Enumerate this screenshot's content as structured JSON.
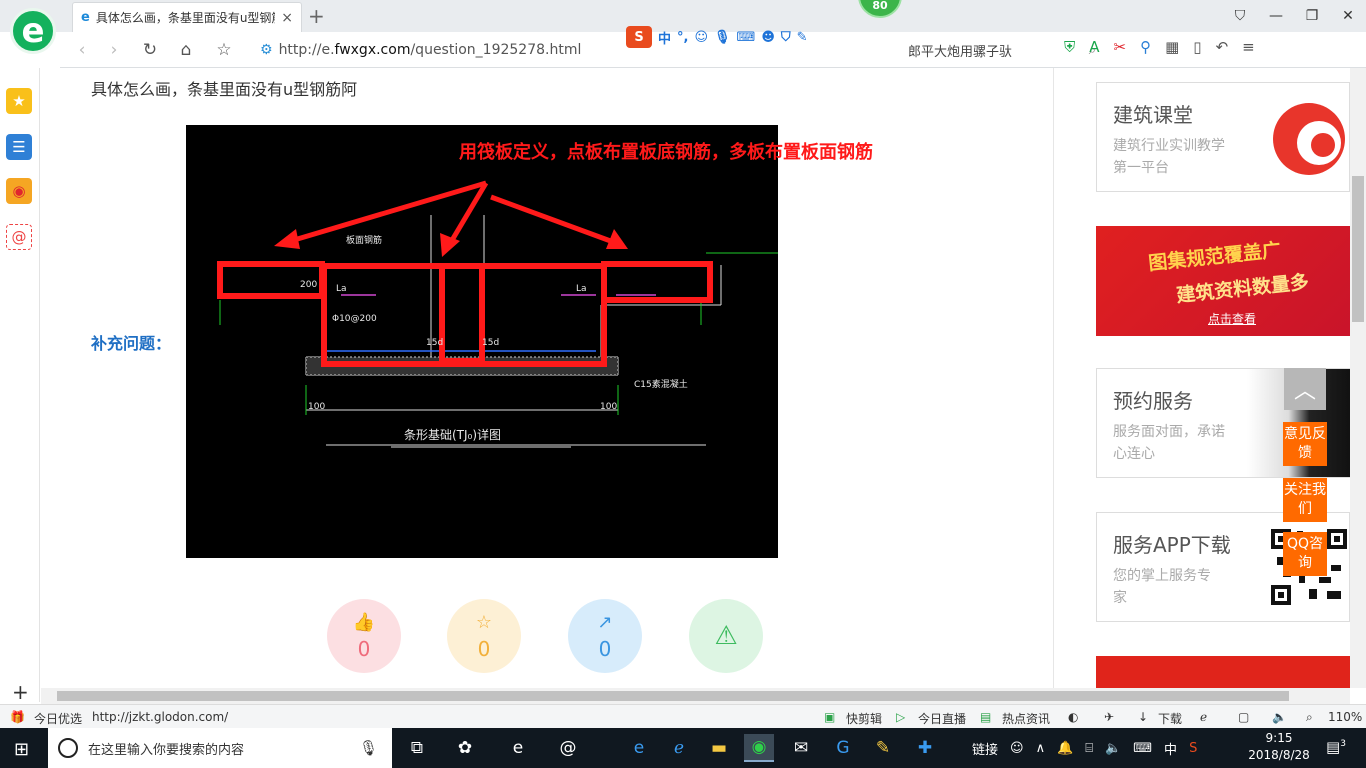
{
  "browser": {
    "tab_title": "具体怎么画，条基里面没有u型钢筋",
    "tab_close": "×",
    "new_tab": "+",
    "address_prefix": "http://e.",
    "address_domain": "fwxgx.com",
    "address_path": "/question_1925278.html",
    "search_text": "郎平大炮用骡子驮",
    "badge": "80",
    "ime_label": "中",
    "logo_letter": "e"
  },
  "page": {
    "question": "具体怎么画，条基里面没有u型钢筋阿",
    "supplement_label": "补充问题：",
    "annotation": "用筏板定义，点板布置板底钢筋，多板布置板面钢筋",
    "cad_texts": {
      "title": "条形基础(TJ₀)详图",
      "c15": "C15素混凝土",
      "dim100a": "100",
      "dim100b": "100",
      "la1": "La",
      "la2": "La",
      "d15a": "15d",
      "d15b": "15d",
      "rebar": "Φ10@200",
      "n200": "200",
      "top_label": "板面钢筋"
    },
    "stats": {
      "like": "0",
      "star": "0",
      "share": "0"
    }
  },
  "right_panel": {
    "card1_title": "建筑课堂",
    "card1_desc": "建筑行业实训教学第一平台",
    "banner_line1": "图集规范覆盖广",
    "banner_line2": "建筑资料数量多",
    "banner_link": "点击查看",
    "card2_title": "预约服务",
    "card2_desc": "服务面对面，承诺心连心",
    "card3_title": "服务APP下载",
    "card3_desc": "您的掌上服务专家"
  },
  "float": {
    "feedback": "意见反馈",
    "follow": "关注我们",
    "qq": "QQ咨询"
  },
  "status": {
    "daily": "今日优选",
    "url": "http://jzkt.glodon.com/",
    "kuaijian": "快剪辑",
    "live": "今日直播",
    "news": "热点资讯",
    "download": "下载",
    "zoom": "110%"
  },
  "taskbar": {
    "search_placeholder": "在这里输入你要搜索的内容",
    "tray_link": "链接",
    "ime": "中",
    "time": "9:15",
    "date": "2018/8/28",
    "notif_count": "3"
  }
}
